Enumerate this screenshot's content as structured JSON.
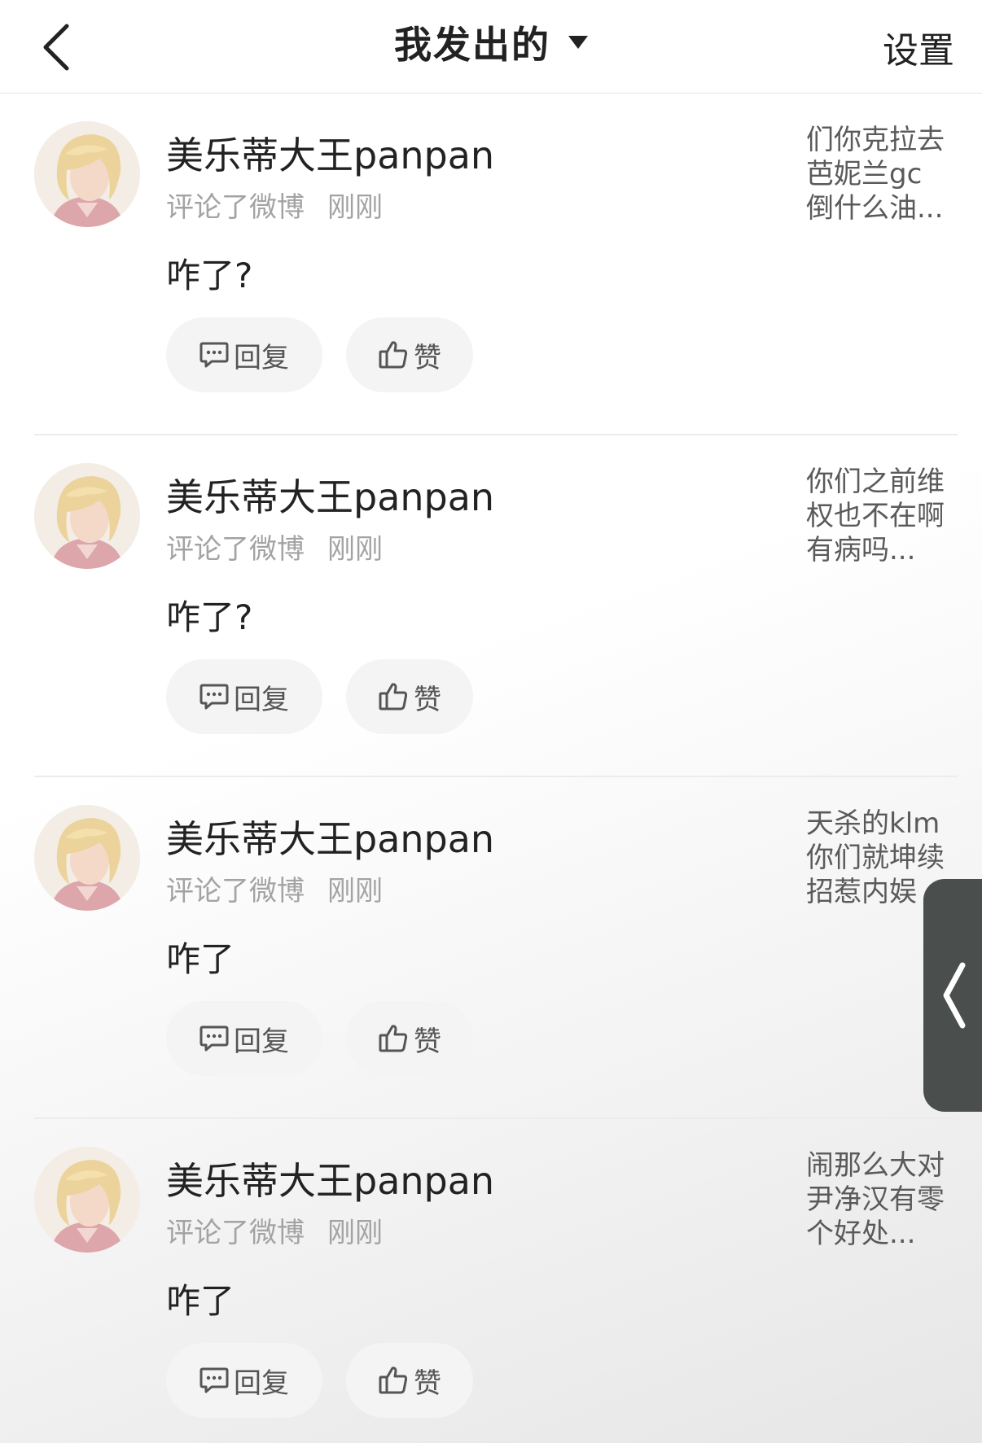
{
  "header": {
    "title": "我发出的",
    "settings_label": "设置"
  },
  "comments": [
    {
      "user_name": "美乐蒂大王panpan",
      "action": "评论了微博",
      "time": "刚刚",
      "text": "咋了?",
      "reply_label": "回复",
      "like_label": "赞",
      "quote_lines": [
        "们你克拉去",
        "芭妮兰gc",
        "倒什么油..."
      ]
    },
    {
      "user_name": "美乐蒂大王panpan",
      "action": "评论了微博",
      "time": "刚刚",
      "text": "咋了?",
      "reply_label": "回复",
      "like_label": "赞",
      "quote_lines": [
        "你们之前维",
        "权也不在啊",
        "有病吗..."
      ]
    },
    {
      "user_name": "美乐蒂大王panpan",
      "action": "评论了微博",
      "time": "刚刚",
      "text": "咋了",
      "reply_label": "回复",
      "like_label": "赞",
      "quote_lines": [
        "天杀的klm",
        "你们就坤续",
        "招惹内娱"
      ]
    },
    {
      "user_name": "美乐蒂大王panpan",
      "action": "评论了微博",
      "time": "刚刚",
      "text": "咋了",
      "reply_label": "回复",
      "like_label": "赞",
      "quote_lines": [
        "闹那么大对",
        "尹净汉有零",
        "个好处..."
      ]
    }
  ],
  "icons": {
    "back": "chevron-left-icon",
    "dropdown": "caret-down-icon",
    "reply": "comment-bubble-icon",
    "like": "thumbs-up-icon",
    "side_tab": "chevron-left-icon"
  },
  "colors": {
    "text_primary": "#222222",
    "text_secondary": "#a3a3a3",
    "pill_bg": "#f4f4f4",
    "side_tab_bg": "#4a4f4e"
  }
}
